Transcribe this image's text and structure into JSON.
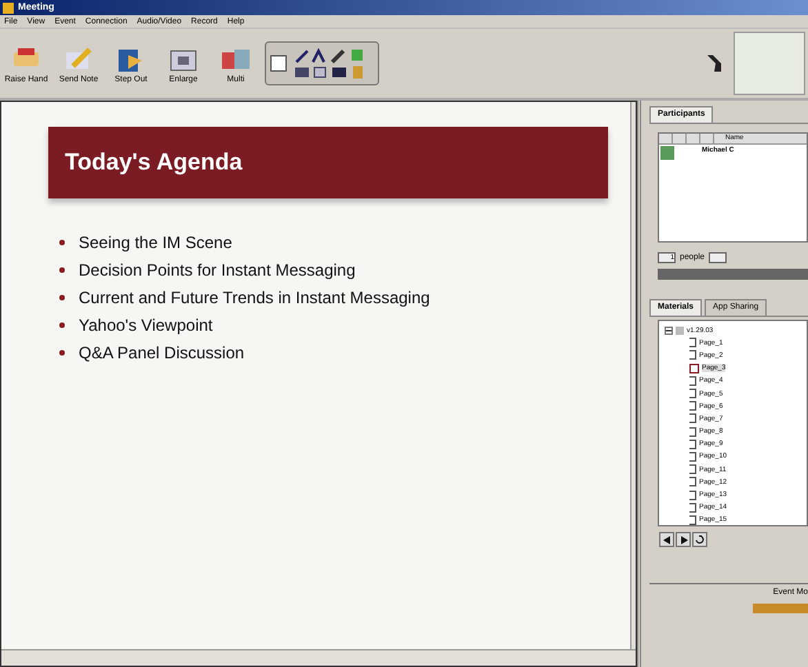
{
  "window": {
    "title": "Meeting"
  },
  "menu": [
    "File",
    "View",
    "Event",
    "Connection",
    "Audio/Video",
    "Record",
    "Help"
  ],
  "toolbar": [
    {
      "label": "Raise Hand",
      "kind": "hand"
    },
    {
      "label": "Send Note",
      "kind": "note"
    },
    {
      "label": "Step Out",
      "kind": "door"
    },
    {
      "label": "Enlarge",
      "kind": "enlarge"
    },
    {
      "label": "Multi",
      "kind": "multi"
    }
  ],
  "slide": {
    "title": "Today's Agenda",
    "bullets": [
      "Seeing the IM Scene",
      "Decision Points for Instant Messaging",
      "Current and Future Trends in Instant Messaging",
      "Yahoo's Viewpoint",
      "Q&A Panel Discussion"
    ]
  },
  "participants": {
    "tab": "Participants",
    "name_column": "Name",
    "rows": [
      {
        "name": "Michael C"
      }
    ],
    "count": "1",
    "count_label": "people"
  },
  "materials": {
    "tabs": [
      {
        "label": "Materials",
        "selected": true
      },
      {
        "label": "App Sharing",
        "selected": false
      }
    ],
    "tree": {
      "label": "v1.29.03",
      "expanded": true,
      "children": [
        {
          "label": "Page_1",
          "selected": false
        },
        {
          "label": "Page_2",
          "selected": false
        },
        {
          "label": "Page_3",
          "selected": true
        },
        {
          "label": "Page_4",
          "selected": false
        },
        {
          "label": "Page_5",
          "selected": false
        },
        {
          "label": "Page_6",
          "selected": false
        },
        {
          "label": "Page_7",
          "selected": false
        },
        {
          "label": "Page_8",
          "selected": false
        },
        {
          "label": "Page_9",
          "selected": false
        },
        {
          "label": "Page_10",
          "selected": false
        },
        {
          "label": "Page_11",
          "selected": false
        },
        {
          "label": "Page_12",
          "selected": false
        },
        {
          "label": "Page_13",
          "selected": false
        },
        {
          "label": "Page_14",
          "selected": false
        },
        {
          "label": "Page_15",
          "selected": false
        }
      ]
    }
  },
  "event_panel": {
    "label": "Event Mo"
  }
}
